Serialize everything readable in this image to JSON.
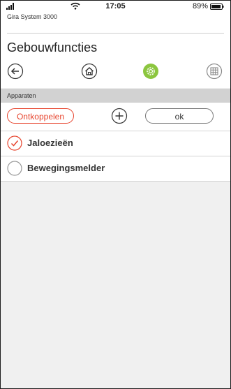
{
  "status": {
    "time": "17:05",
    "battery": "89%"
  },
  "app": {
    "brand": "Gira System 3000",
    "title": "Gebouwfuncties"
  },
  "nav": {
    "icons": [
      "back-icon",
      "home-icon",
      "settings-icon",
      "grid-icon"
    ],
    "active": "settings-icon",
    "accent": "#8cc63f"
  },
  "section": {
    "label": "Apparaten"
  },
  "actions": {
    "unlink_label": "Ontkoppelen",
    "ok_label": "ok",
    "accent": "#e7432c"
  },
  "devices": [
    {
      "label": "Jaloezieën",
      "checked": true
    },
    {
      "label": "Bewegingsmelder",
      "checked": false
    }
  ]
}
